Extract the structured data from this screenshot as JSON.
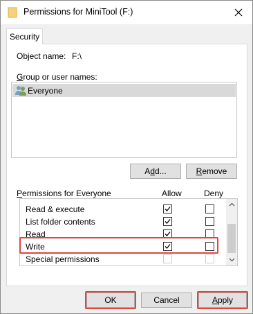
{
  "window": {
    "title": "Permissions for MiniTool (F:)"
  },
  "tabs": [
    {
      "label": "Security"
    }
  ],
  "object": {
    "label": "Object name:",
    "value": "F:\\"
  },
  "groups": {
    "label_prefix": "",
    "label_access_key": "G",
    "label_rest": "roup or user names:",
    "items": [
      {
        "name": "Everyone",
        "selected": true
      }
    ]
  },
  "buttons": {
    "add": {
      "pre": "A",
      "key": "d",
      "post": "d..."
    },
    "remove": {
      "pre": "",
      "key": "R",
      "post": "emove"
    },
    "ok": "OK",
    "cancel": "Cancel",
    "apply": {
      "pre": "",
      "key": "A",
      "post": "pply"
    }
  },
  "permissions": {
    "label_prefix": "",
    "label_access_key": "P",
    "label_rest": "ermissions for Everyone",
    "allow_header": "Allow",
    "deny_header": "Deny",
    "rows": [
      {
        "name": "Read & execute",
        "allow": true,
        "deny": false,
        "disabled": false
      },
      {
        "name": "List folder contents",
        "allow": true,
        "deny": false,
        "disabled": false
      },
      {
        "name": "Read",
        "allow": true,
        "deny": false,
        "disabled": false
      },
      {
        "name": "Write",
        "allow": true,
        "deny": false,
        "disabled": false
      },
      {
        "name": "Special permissions",
        "allow": false,
        "deny": false,
        "disabled": true
      }
    ]
  },
  "colors": {
    "highlight": "#e0443d",
    "selection": "#d9d9d9",
    "button_face": "#e1e1e1"
  },
  "icons": {
    "title": "folder-icon",
    "close": "close-icon",
    "user": "users-group-icon",
    "scroll_up": "chevron-up-icon",
    "scroll_down": "chevron-down-icon",
    "check": "checkmark-icon"
  }
}
